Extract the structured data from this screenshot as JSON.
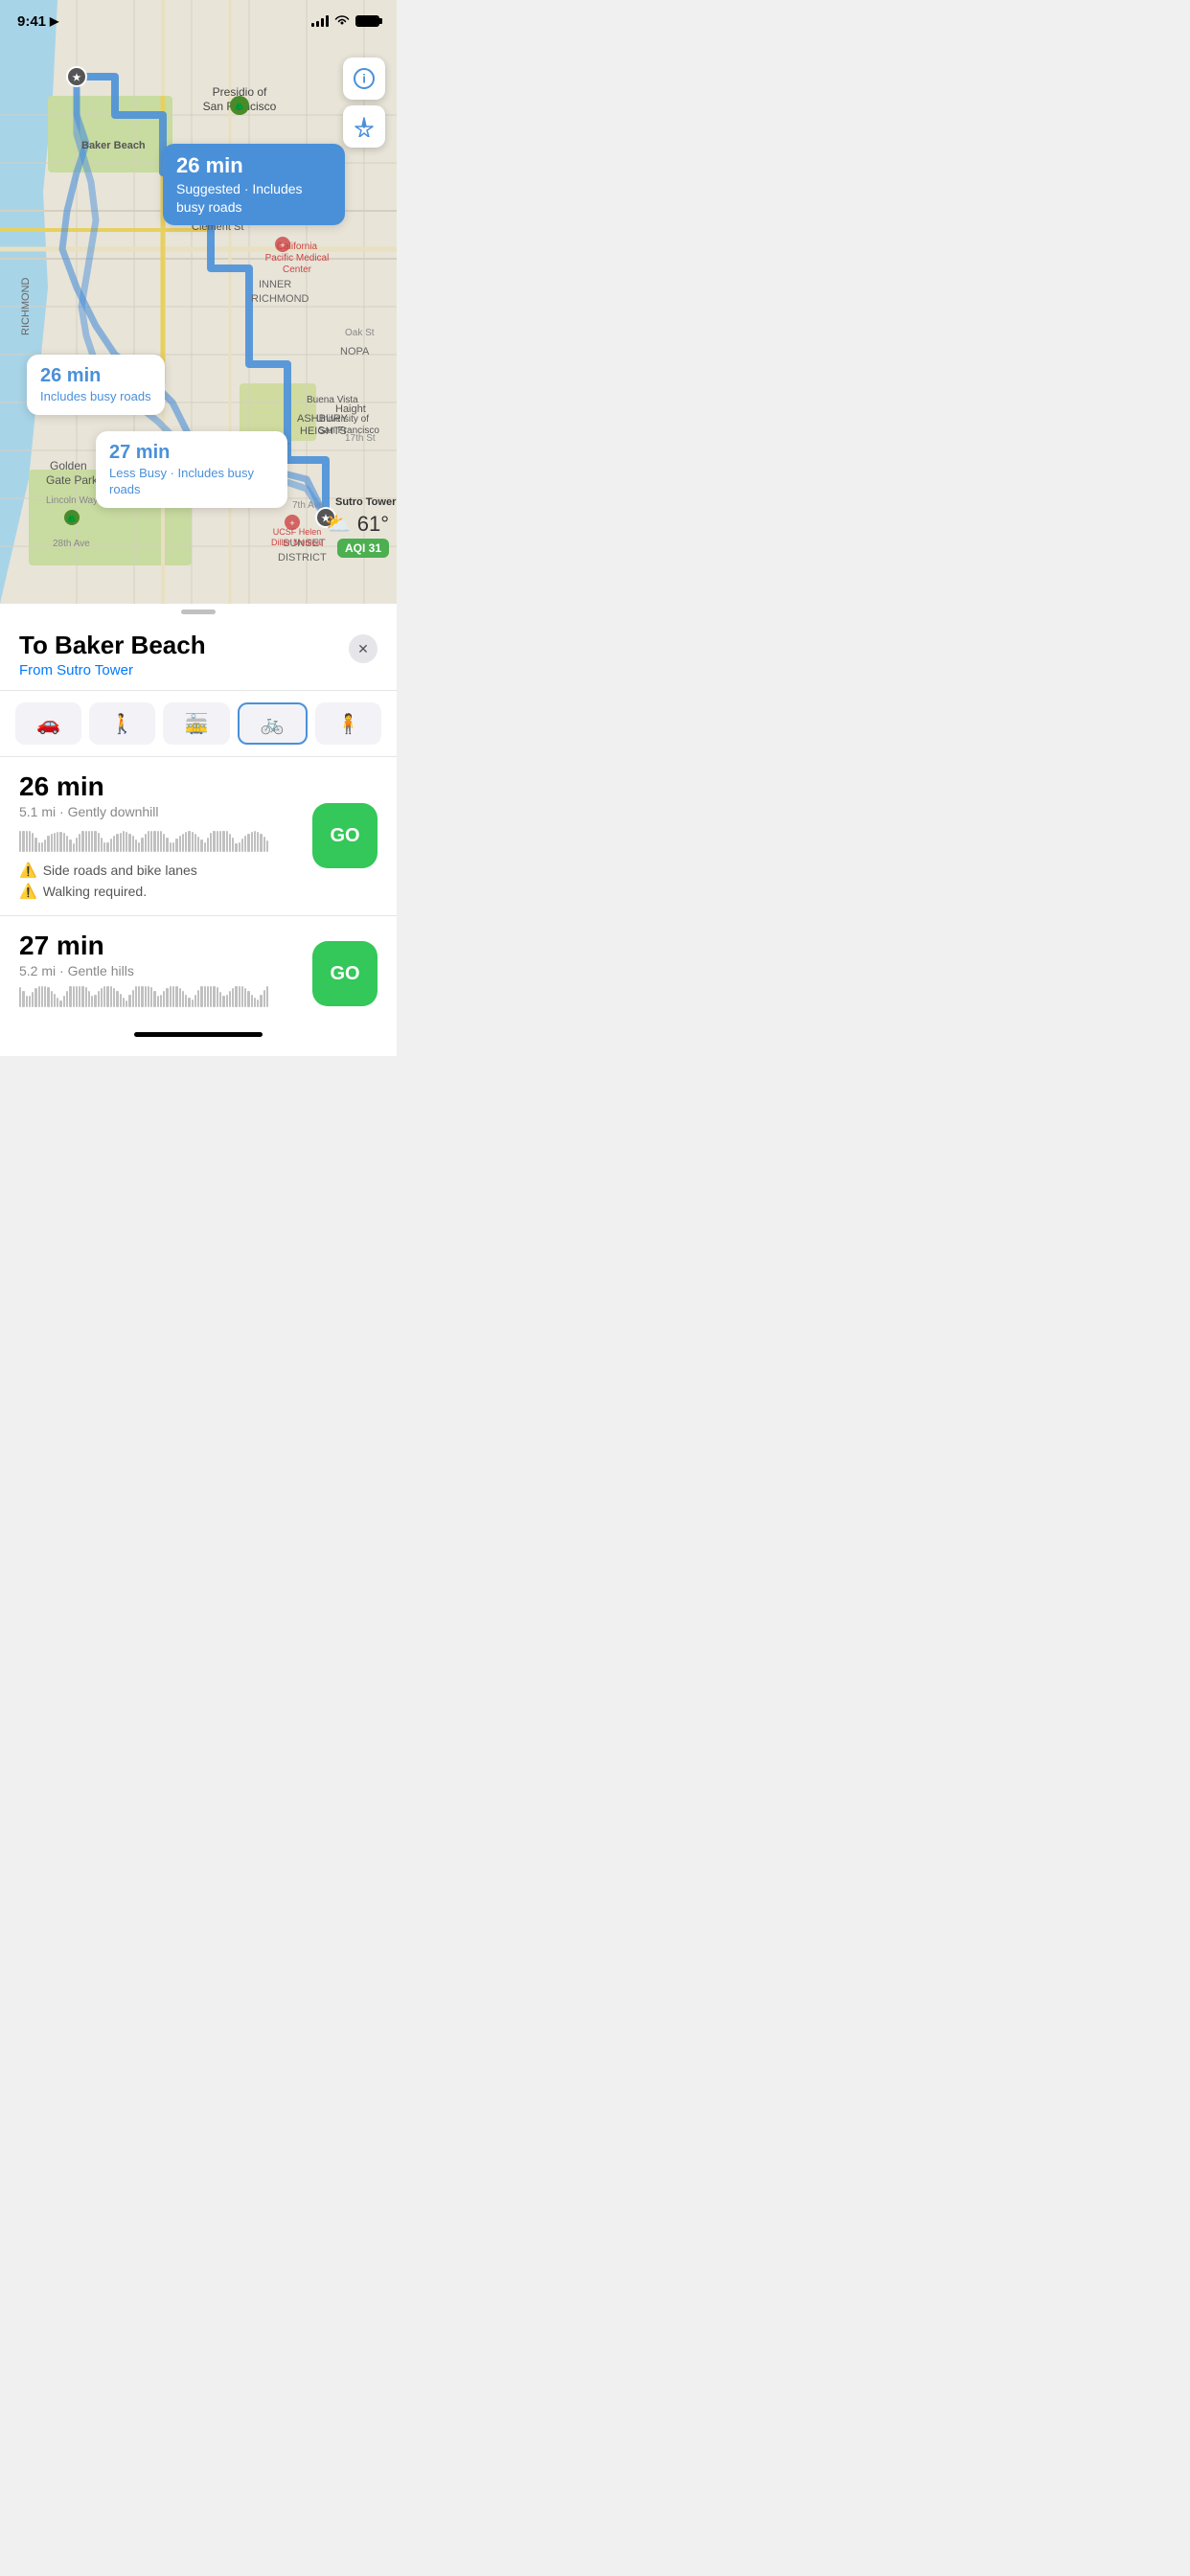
{
  "status": {
    "time": "9:41",
    "location_arrow": "▶"
  },
  "map": {
    "info_icon": "ℹ",
    "locate_icon": "➤",
    "weather": {
      "icon": "⛅",
      "temp": "61°",
      "aqi_label": "AQI 31"
    },
    "callouts": [
      {
        "id": "main",
        "time": "26 min",
        "desc": "Suggested · Includes busy roads",
        "style": "blue"
      },
      {
        "id": "alt1",
        "time": "26 min",
        "desc": "Includes busy roads",
        "style": "white"
      },
      {
        "id": "alt2",
        "time": "27 min",
        "desc": "Less Busy · Includes busy roads",
        "style": "white"
      }
    ]
  },
  "panel": {
    "title": "To Baker Beach",
    "from_label": "From",
    "from_place": "Sutro Tower",
    "close_icon": "✕"
  },
  "transport_tabs": [
    {
      "id": "drive",
      "icon": "🚗",
      "label": "Drive",
      "active": false
    },
    {
      "id": "walk",
      "icon": "🚶",
      "label": "Walk",
      "active": false
    },
    {
      "id": "transit",
      "icon": "🚋",
      "label": "Transit",
      "active": false
    },
    {
      "id": "bike",
      "icon": "🚲",
      "label": "Bike",
      "active": true
    },
    {
      "id": "rideshare",
      "icon": "🧍",
      "label": "Rideshare",
      "active": false
    }
  ],
  "routes": [
    {
      "time": "26 min",
      "distance": "5.1 mi",
      "terrain": "Gently downhill",
      "warnings": [
        "Side roads and bike lanes",
        "Walking required."
      ],
      "go_label": "GO"
    },
    {
      "time": "27 min",
      "distance": "5.2 mi",
      "terrain": "Gentle hills",
      "warnings": [],
      "go_label": "GO"
    }
  ]
}
